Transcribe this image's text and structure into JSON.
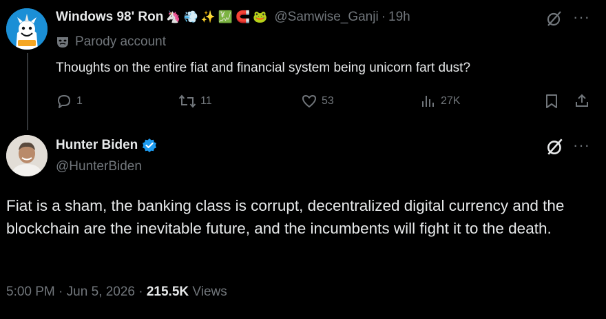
{
  "parent": {
    "display_name": "Windows 98' Ron",
    "name_emojis": [
      "🦄",
      "💨",
      "✨",
      "💹",
      "🧲",
      "🐸"
    ],
    "handle": "@Samwise_Ganji",
    "separator": "·",
    "time": "19h",
    "label_icon": "mask-icon",
    "label": "Parody account",
    "text": "Thoughts on the entire fiat and financial system being unicorn fart dust?",
    "replies": "1",
    "reposts": "11",
    "likes": "53",
    "views": "27K"
  },
  "main": {
    "display_name": "Hunter Biden",
    "verified_color": "#1d9bf0",
    "handle": "@HunterBiden",
    "text": "Fiat is a sham, the banking class is corrupt, decentralized digital currency and the blockchain are the inevitable future, and the incumbents will fight it to the death.",
    "time": "5:00 PM",
    "date": "Jun 5, 2026",
    "separator": "·",
    "view_count": "215.5K",
    "views_label": "Views"
  },
  "colors": {
    "background": "#000000",
    "text": "#e7e9ea",
    "muted": "#71767b",
    "accent": "#1d9bf0"
  }
}
